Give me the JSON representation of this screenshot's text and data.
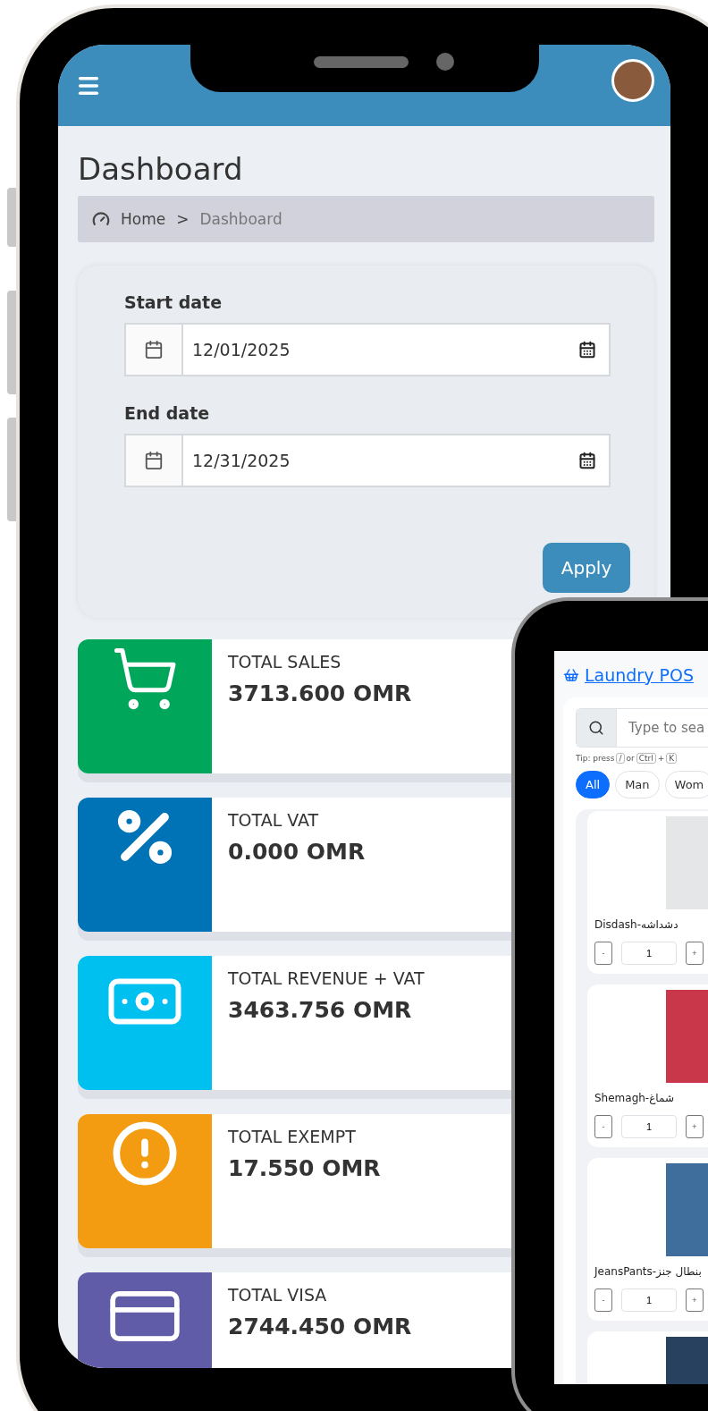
{
  "header": {
    "title": "Dashboard"
  },
  "breadcrumb": [
    {
      "label": "Home",
      "current": false
    },
    {
      "label": ">",
      "current": false
    },
    {
      "label": "Dashboard",
      "current": true
    }
  ],
  "filters": [
    {
      "label": "Start date",
      "value": "12/01/2025"
    },
    {
      "label": "End date",
      "value": "12/31/2025"
    }
  ],
  "apply_button": "Apply",
  "stats": [
    {
      "kind": "cart",
      "label": "TOTAL SALES",
      "value": "3713.600 OMR",
      "color": "#00a65a"
    },
    {
      "kind": "percent",
      "label": "TOTAL VAT",
      "value": "0.000 OMR",
      "color": "#0073b7"
    },
    {
      "kind": "money",
      "label": "TOTAL REVENUE + VAT",
      "value": "3463.756 OMR",
      "color": "#00c0ef"
    },
    {
      "kind": "alert",
      "label": "TOTAL EXEMPT",
      "value": "17.550 OMR",
      "color": "#f39c12"
    },
    {
      "kind": "card",
      "label": "TOTAL VISA",
      "value": "2744.450 OMR",
      "color": "#605ca8"
    }
  ],
  "pos": {
    "brand": "Laundry POS",
    "search_placeholder": "Type to sea",
    "tip": [
      "Tip: press",
      "/",
      "or",
      "Ctrl",
      "+",
      "K"
    ],
    "categories": [
      {
        "label": "All",
        "selected": true
      },
      {
        "label": "Man",
        "selected": false
      },
      {
        "label": "Wom",
        "selected": false
      }
    ],
    "products": [
      {
        "name": "Disdash-دشداشه",
        "qty": "1",
        "minus": "-",
        "plus": "+",
        "kind": "light"
      },
      {
        "name": "Shemagh-شماغ",
        "qty": "1",
        "minus": "-",
        "plus": "+",
        "kind": "red"
      },
      {
        "name": "JeansPants-بنطال جنز",
        "qty": "1",
        "minus": "-",
        "plus": "+",
        "kind": "blue"
      },
      {
        "kind": "dark"
      }
    ]
  }
}
